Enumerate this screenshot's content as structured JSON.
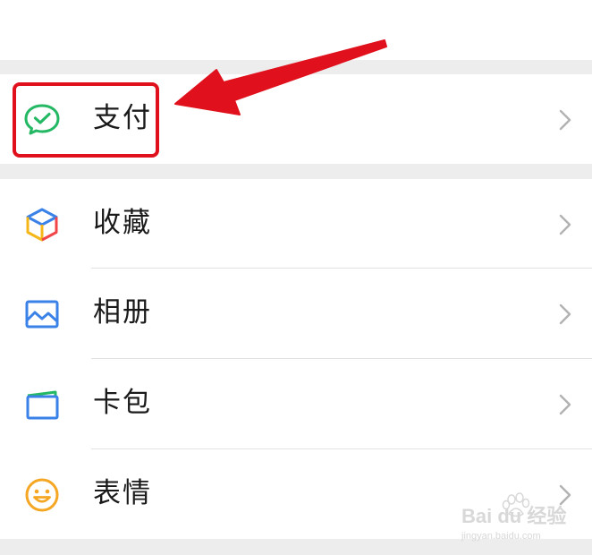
{
  "menu": {
    "items": [
      {
        "label": "支付",
        "icon": "wechat-pay-icon"
      },
      {
        "label": "收藏",
        "icon": "favorites-cube-icon"
      },
      {
        "label": "相册",
        "icon": "album-picture-icon"
      },
      {
        "label": "卡包",
        "icon": "card-wallet-icon"
      },
      {
        "label": "表情",
        "icon": "smiley-face-icon"
      }
    ],
    "chevron_icon": "chevron-right-icon"
  },
  "annotation": {
    "highlight_color": "#e0101c",
    "arrow_color": "#e0101c",
    "target": "支付"
  },
  "watermark": {
    "line1": "Bai du 经验",
    "line2": "jingyan.baidu.com"
  },
  "colors": {
    "background": "#ededed",
    "row_background": "#ffffff",
    "pay_green": "#25b864",
    "chevron": "#b2b2b2"
  }
}
